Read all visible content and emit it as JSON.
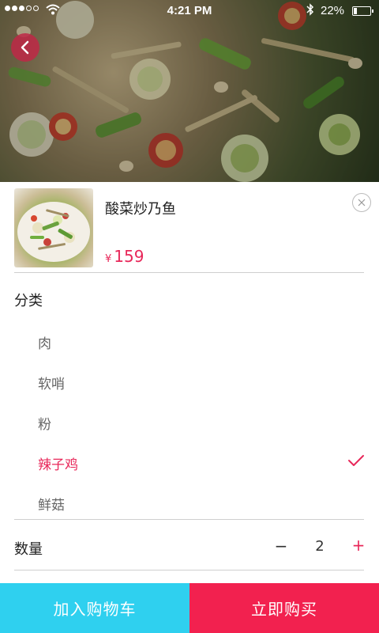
{
  "status_bar": {
    "time": "4:21 PM",
    "battery_percent": "22%",
    "battery_level": 0.22,
    "signal_bars_filled": 3,
    "signal_bars_total": 5
  },
  "icons": {
    "back": "chevron-left-icon",
    "close": "close-circle-icon",
    "check": "checkmark-icon",
    "wifi": "wifi-icon",
    "bluetooth": "bluetooth-icon"
  },
  "colors": {
    "accent": "#e8285a",
    "cart_button": "#2fd0ef",
    "buy_button": "#f2214f"
  },
  "product": {
    "name": "酸菜炒乃鱼",
    "currency": "¥",
    "price": "159"
  },
  "category": {
    "title": "分类",
    "options": [
      {
        "label": "肉",
        "selected": false
      },
      {
        "label": "软哨",
        "selected": false
      },
      {
        "label": "粉",
        "selected": false
      },
      {
        "label": "辣子鸡",
        "selected": true
      },
      {
        "label": "鲜菇",
        "selected": false
      }
    ]
  },
  "quantity": {
    "label": "数量",
    "minus": "−",
    "value": "2",
    "plus": "+"
  },
  "actions": {
    "add_to_cart": "加入购物车",
    "buy_now": "立即购买"
  }
}
